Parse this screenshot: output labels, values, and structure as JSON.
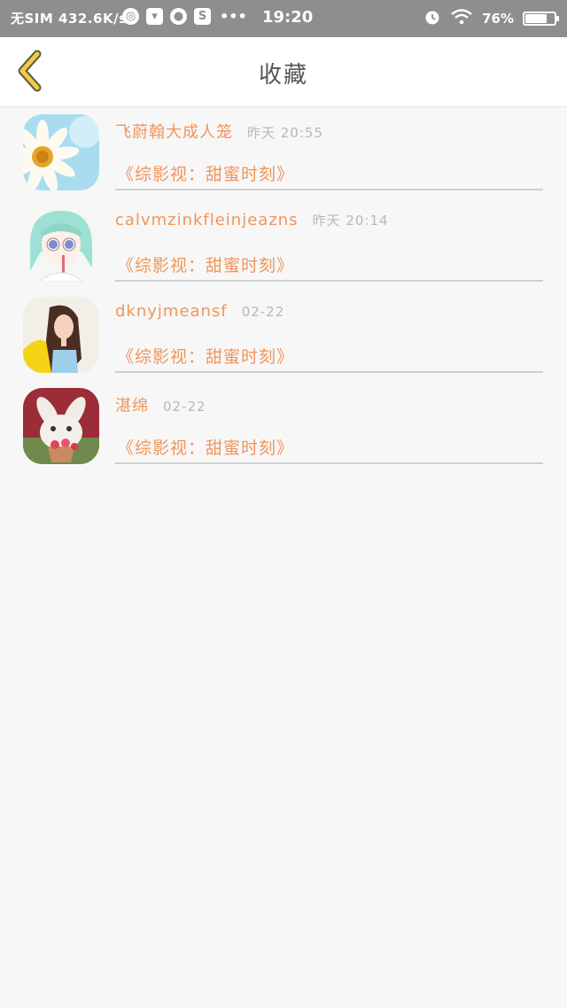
{
  "status_bar": {
    "network_text": "无SIM 432.6K/s",
    "time": "19:20",
    "battery": "76%",
    "battery_level": 0.76,
    "more": "•••",
    "s_icon_text": "S"
  },
  "header": {
    "title": "收藏"
  },
  "favorites": [
    {
      "username": "飞蔚翰大成人笼",
      "time": "昨天 20:55",
      "book": "《综影视：甜蜜时刻》",
      "avatar": "daisy-avatar"
    },
    {
      "username": "calvmzinkfleinjeazns",
      "time": "昨天 20:14",
      "book": "《综影视：甜蜜时刻》",
      "avatar": "anime-girl-avatar"
    },
    {
      "username": "dknyjmeansf",
      "time": "02-22",
      "book": "《综影视：甜蜜时刻》",
      "avatar": "woman-photo-avatar"
    },
    {
      "username": "湛绵",
      "time": "02-22",
      "book": "《综影视：甜蜜时刻》",
      "avatar": "bunny-avatar"
    }
  ],
  "colors": {
    "accent": "#f0955b",
    "muted": "#b8b8b8",
    "back_arrow": "#f3c94a"
  }
}
